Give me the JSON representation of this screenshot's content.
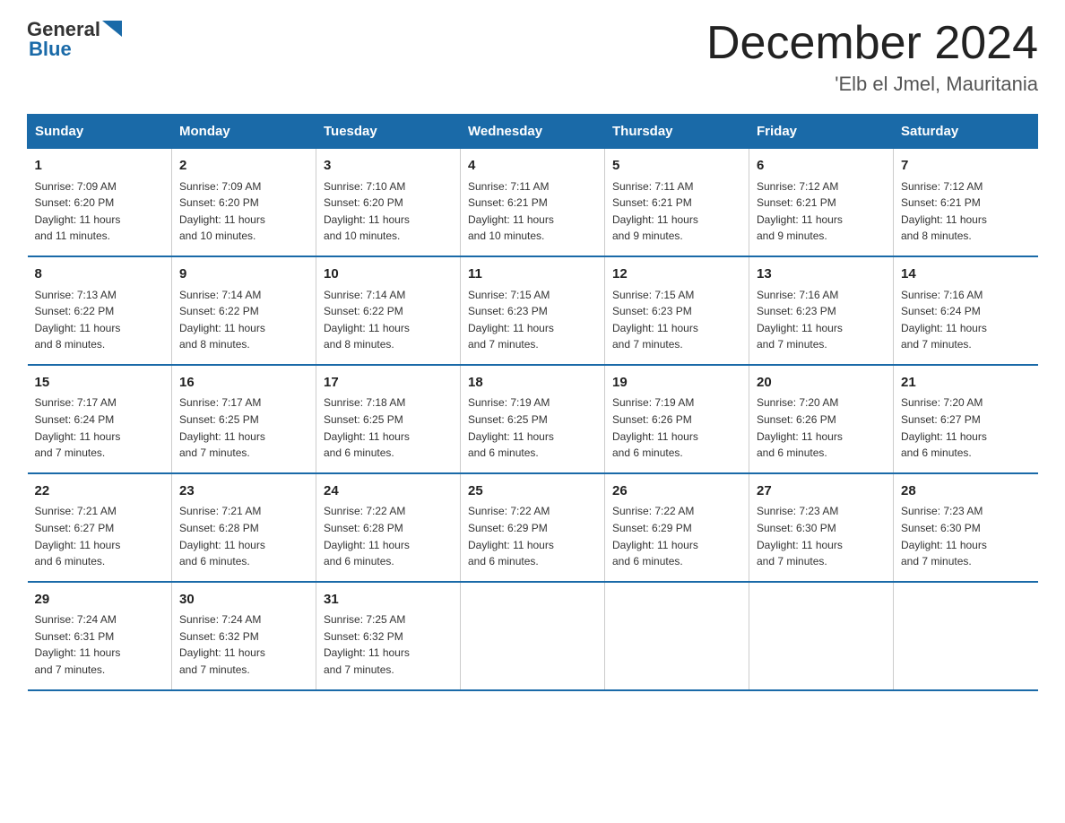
{
  "header": {
    "logo_general": "General",
    "logo_blue": "Blue",
    "month_title": "December 2024",
    "location": "'Elb el Jmel, Mauritania"
  },
  "days_of_week": [
    "Sunday",
    "Monday",
    "Tuesday",
    "Wednesday",
    "Thursday",
    "Friday",
    "Saturday"
  ],
  "weeks": [
    [
      {
        "day": "1",
        "sunrise": "7:09 AM",
        "sunset": "6:20 PM",
        "daylight": "11 hours and 11 minutes."
      },
      {
        "day": "2",
        "sunrise": "7:09 AM",
        "sunset": "6:20 PM",
        "daylight": "11 hours and 10 minutes."
      },
      {
        "day": "3",
        "sunrise": "7:10 AM",
        "sunset": "6:20 PM",
        "daylight": "11 hours and 10 minutes."
      },
      {
        "day": "4",
        "sunrise": "7:11 AM",
        "sunset": "6:21 PM",
        "daylight": "11 hours and 10 minutes."
      },
      {
        "day": "5",
        "sunrise": "7:11 AM",
        "sunset": "6:21 PM",
        "daylight": "11 hours and 9 minutes."
      },
      {
        "day": "6",
        "sunrise": "7:12 AM",
        "sunset": "6:21 PM",
        "daylight": "11 hours and 9 minutes."
      },
      {
        "day": "7",
        "sunrise": "7:12 AM",
        "sunset": "6:21 PM",
        "daylight": "11 hours and 8 minutes."
      }
    ],
    [
      {
        "day": "8",
        "sunrise": "7:13 AM",
        "sunset": "6:22 PM",
        "daylight": "11 hours and 8 minutes."
      },
      {
        "day": "9",
        "sunrise": "7:14 AM",
        "sunset": "6:22 PM",
        "daylight": "11 hours and 8 minutes."
      },
      {
        "day": "10",
        "sunrise": "7:14 AM",
        "sunset": "6:22 PM",
        "daylight": "11 hours and 8 minutes."
      },
      {
        "day": "11",
        "sunrise": "7:15 AM",
        "sunset": "6:23 PM",
        "daylight": "11 hours and 7 minutes."
      },
      {
        "day": "12",
        "sunrise": "7:15 AM",
        "sunset": "6:23 PM",
        "daylight": "11 hours and 7 minutes."
      },
      {
        "day": "13",
        "sunrise": "7:16 AM",
        "sunset": "6:23 PM",
        "daylight": "11 hours and 7 minutes."
      },
      {
        "day": "14",
        "sunrise": "7:16 AM",
        "sunset": "6:24 PM",
        "daylight": "11 hours and 7 minutes."
      }
    ],
    [
      {
        "day": "15",
        "sunrise": "7:17 AM",
        "sunset": "6:24 PM",
        "daylight": "11 hours and 7 minutes."
      },
      {
        "day": "16",
        "sunrise": "7:17 AM",
        "sunset": "6:25 PM",
        "daylight": "11 hours and 7 minutes."
      },
      {
        "day": "17",
        "sunrise": "7:18 AM",
        "sunset": "6:25 PM",
        "daylight": "11 hours and 6 minutes."
      },
      {
        "day": "18",
        "sunrise": "7:19 AM",
        "sunset": "6:25 PM",
        "daylight": "11 hours and 6 minutes."
      },
      {
        "day": "19",
        "sunrise": "7:19 AM",
        "sunset": "6:26 PM",
        "daylight": "11 hours and 6 minutes."
      },
      {
        "day": "20",
        "sunrise": "7:20 AM",
        "sunset": "6:26 PM",
        "daylight": "11 hours and 6 minutes."
      },
      {
        "day": "21",
        "sunrise": "7:20 AM",
        "sunset": "6:27 PM",
        "daylight": "11 hours and 6 minutes."
      }
    ],
    [
      {
        "day": "22",
        "sunrise": "7:21 AM",
        "sunset": "6:27 PM",
        "daylight": "11 hours and 6 minutes."
      },
      {
        "day": "23",
        "sunrise": "7:21 AM",
        "sunset": "6:28 PM",
        "daylight": "11 hours and 6 minutes."
      },
      {
        "day": "24",
        "sunrise": "7:22 AM",
        "sunset": "6:28 PM",
        "daylight": "11 hours and 6 minutes."
      },
      {
        "day": "25",
        "sunrise": "7:22 AM",
        "sunset": "6:29 PM",
        "daylight": "11 hours and 6 minutes."
      },
      {
        "day": "26",
        "sunrise": "7:22 AM",
        "sunset": "6:29 PM",
        "daylight": "11 hours and 6 minutes."
      },
      {
        "day": "27",
        "sunrise": "7:23 AM",
        "sunset": "6:30 PM",
        "daylight": "11 hours and 7 minutes."
      },
      {
        "day": "28",
        "sunrise": "7:23 AM",
        "sunset": "6:30 PM",
        "daylight": "11 hours and 7 minutes."
      }
    ],
    [
      {
        "day": "29",
        "sunrise": "7:24 AM",
        "sunset": "6:31 PM",
        "daylight": "11 hours and 7 minutes."
      },
      {
        "day": "30",
        "sunrise": "7:24 AM",
        "sunset": "6:32 PM",
        "daylight": "11 hours and 7 minutes."
      },
      {
        "day": "31",
        "sunrise": "7:25 AM",
        "sunset": "6:32 PM",
        "daylight": "11 hours and 7 minutes."
      },
      null,
      null,
      null,
      null
    ]
  ],
  "labels": {
    "sunrise": "Sunrise:",
    "sunset": "Sunset:",
    "daylight": "Daylight:"
  }
}
